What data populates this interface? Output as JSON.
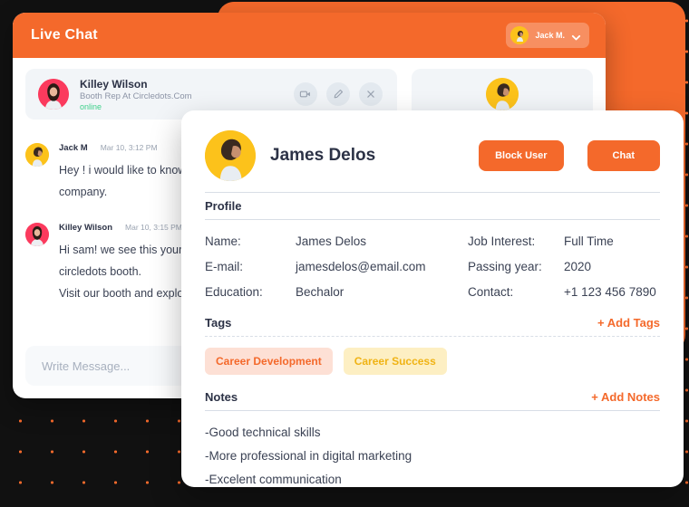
{
  "theme": {
    "accent": "#F4692B",
    "canvas": "#111111",
    "dot": "#F4692B",
    "panel_bg": "#F2F5F8",
    "tag_peach_bg": "#FDE0D5",
    "tag_peach_fg": "#F4692B",
    "tag_yellow_bg": "#FDEFC3",
    "tag_yellow_fg": "#F0B314",
    "online_green": "#3FD08B"
  },
  "chat_window": {
    "title": "Live Chat",
    "account": {
      "name": "Jack M.",
      "avatar": "user-avatar",
      "chevron": "chevron-down-icon"
    },
    "contact": {
      "name": "Killey Wilson",
      "role": "Booth Rep At Circledots.Com",
      "status": "online",
      "avatar": "contact-avatar"
    },
    "actions": [
      {
        "icon": "video-camera-icon",
        "label": "Video call"
      },
      {
        "icon": "pen-icon",
        "label": "Edit"
      },
      {
        "icon": "close-icon",
        "label": "Close"
      }
    ],
    "messages": [
      {
        "author": "Jack M",
        "time": "Mar 10, 3:12 PM",
        "avatar": "user-avatar",
        "lines": [
          "Hey ! i would like to  know more about your",
          "company."
        ]
      },
      {
        "author": "Killey Wilson",
        "time": "Mar 10, 3:15 PM",
        "avatar": "contact-avatar",
        "lines": [
          "Hi sam! we see this your think about",
          "circledots booth.",
          "Visit our booth and explore more."
        ]
      }
    ],
    "composer": {
      "placeholder": "Write Message...",
      "value": ""
    }
  },
  "profile_card": {
    "avatar": "profile-avatar",
    "name": "James Delos",
    "buttons": {
      "block": "Block User",
      "chat": "Chat"
    },
    "section_profile": "Profile",
    "fields": [
      {
        "key": "Name:",
        "value": "James Delos",
        "key2": "Job Interest:",
        "value2": "Full Time"
      },
      {
        "key": "E-mail:",
        "value": "jamesdelos@email.com",
        "key2": "Passing year:",
        "value2": "2020"
      },
      {
        "key": "Education:",
        "value": "Bechalor",
        "key2": "Contact:",
        "value2": "+1 123 456 7890"
      }
    ],
    "tags_section": {
      "title": "Tags",
      "add_label": "+ Add Tags",
      "items": [
        {
          "label": "Career Development",
          "style": "peach"
        },
        {
          "label": "Career Success",
          "style": "yellow"
        }
      ]
    },
    "notes_section": {
      "title": "Notes",
      "add_label": "+ Add Notes",
      "items": [
        "-Good technical skills",
        "-More professional in digital marketing",
        "-Excelent communication"
      ]
    }
  }
}
